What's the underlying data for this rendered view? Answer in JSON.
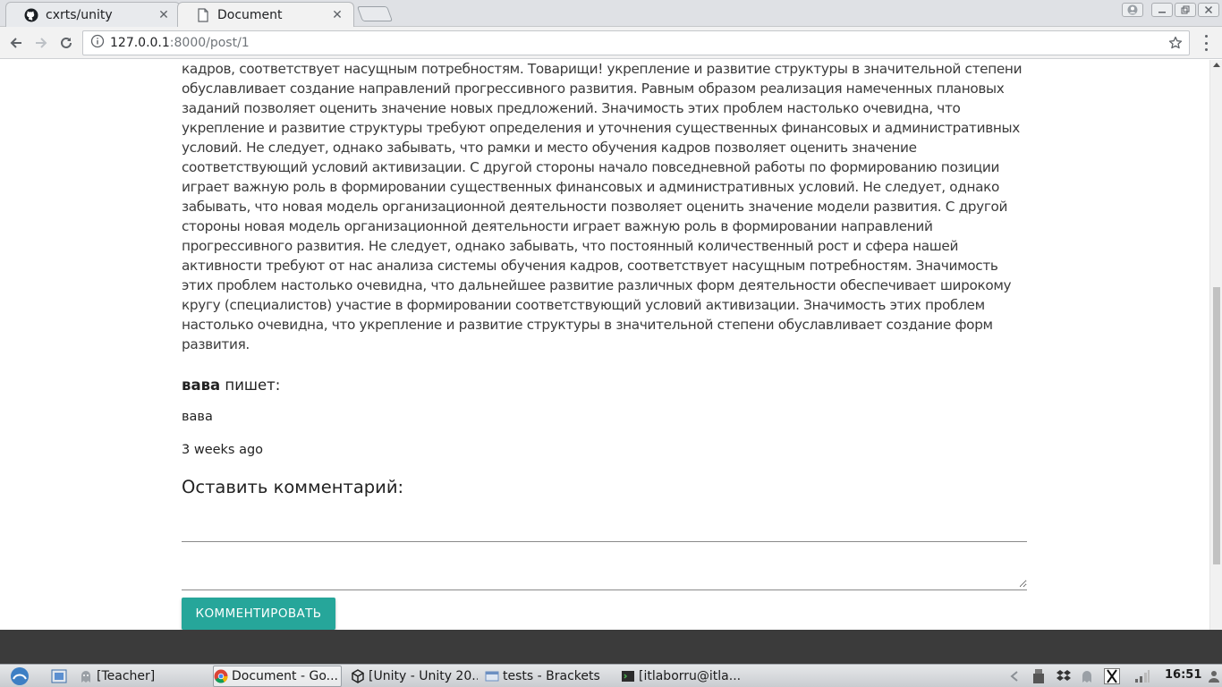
{
  "browser": {
    "tabs": [
      {
        "title": "cxrts/unity",
        "icon": "github-icon",
        "active": false
      },
      {
        "title": "Document",
        "icon": "page-icon",
        "active": true
      }
    ],
    "close_symbol": "✕",
    "url_host": "127.0.0.1",
    "url_path": ":8000/post/1"
  },
  "post": {
    "body": "кадров, соответствует насущным потребностям. Товарищи! укрепление и развитие структуры в значительной степени обуславливает создание направлений прогрессивного развития. Равным образом реализация намеченных плановых заданий позволяет оценить значение новых предложений. Значимость этих проблем настолько очевидна, что укрепление и развитие структуры требуют определения и уточнения существенных финансовых и административных условий. Не следует, однако забывать, что рамки и место обучения кадров позволяет оценить значение соответствующий условий активизации. С другой стороны начало повседневной работы по формированию позиции играет важную роль в формировании существенных финансовых и административных условий. Не следует, однако забывать, что новая модель организационной деятельности позволяет оценить значение модели развития. С другой стороны новая модель организационной деятельности играет важную роль в формировании направлений прогрессивного развития. Не следует, однако забывать, что постоянный количественный рост и сфера нашей активности требуют от нас анализа системы обучения кадров, соответствует насущным потребностям. Значимость этих проблем настолько очевидна, что дальнейшее развитие различных форм деятельности обеспечивает широкому кругу (специалистов) участие в формировании соответствующий условий активизации. Значимость этих проблем настолько очевидна, что укрепление и развитие структуры в значительной степени обуславливает создание форм развития."
  },
  "comment": {
    "author": "вава",
    "verb": " пишет:",
    "text": "вава",
    "time": "3 weeks ago"
  },
  "form": {
    "title": "Оставить комментарий:",
    "submit_label": "КОММЕНТИРОВАТЬ",
    "accent_color": "#26a69a"
  },
  "taskbar": {
    "items": [
      {
        "label": "[Teacher]",
        "icon": "ghost-icon"
      },
      {
        "label": "Document - Go...",
        "icon": "chrome-icon"
      },
      {
        "label": "[Unity - Unity 20...",
        "icon": "unity-icon"
      },
      {
        "label": "tests - Brackets",
        "icon": "brackets-icon"
      },
      {
        "label": "[itlaborru@itla...",
        "icon": "terminal-icon"
      }
    ],
    "clock": "16:51"
  }
}
